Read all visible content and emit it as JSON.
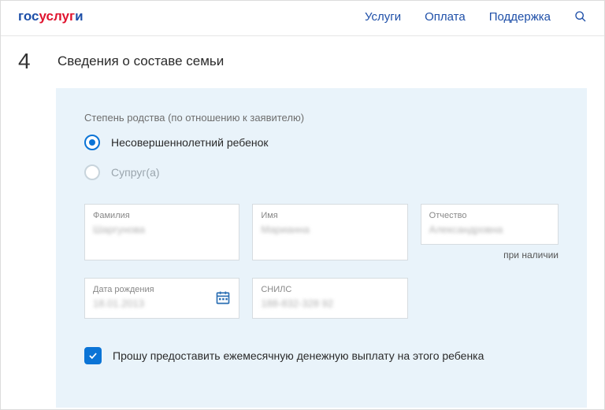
{
  "brand": {
    "text_blue1": "гос",
    "text_red": "услуг",
    "text_blue2": "и"
  },
  "nav": {
    "services": "Услуги",
    "payment": "Оплата",
    "support": "Поддержка"
  },
  "section": {
    "step_num": "4",
    "title": "Сведения о составе семьи"
  },
  "relationship": {
    "label": "Степень родства (по отношению к заявителю)",
    "options": [
      {
        "label": "Несовершеннолетний ребенок",
        "selected": true
      },
      {
        "label": "Супруг(а)",
        "selected": false,
        "disabled": true
      }
    ]
  },
  "fields": {
    "lastname": {
      "label": "Фамилия",
      "value": "Шаргунова"
    },
    "firstname": {
      "label": "Имя",
      "value": "Марианна"
    },
    "patronymic": {
      "label": "Отчество",
      "value": "Александровна",
      "hint": "при наличии"
    },
    "birthdate": {
      "label": "Дата рождения",
      "value": "18.01.2013"
    },
    "snils": {
      "label": "СНИЛС",
      "value": "188-832-328 92"
    }
  },
  "checkbox": {
    "label": "Прошу предоставить ежемесячную денежную выплату на этого ребенка",
    "checked": true
  }
}
